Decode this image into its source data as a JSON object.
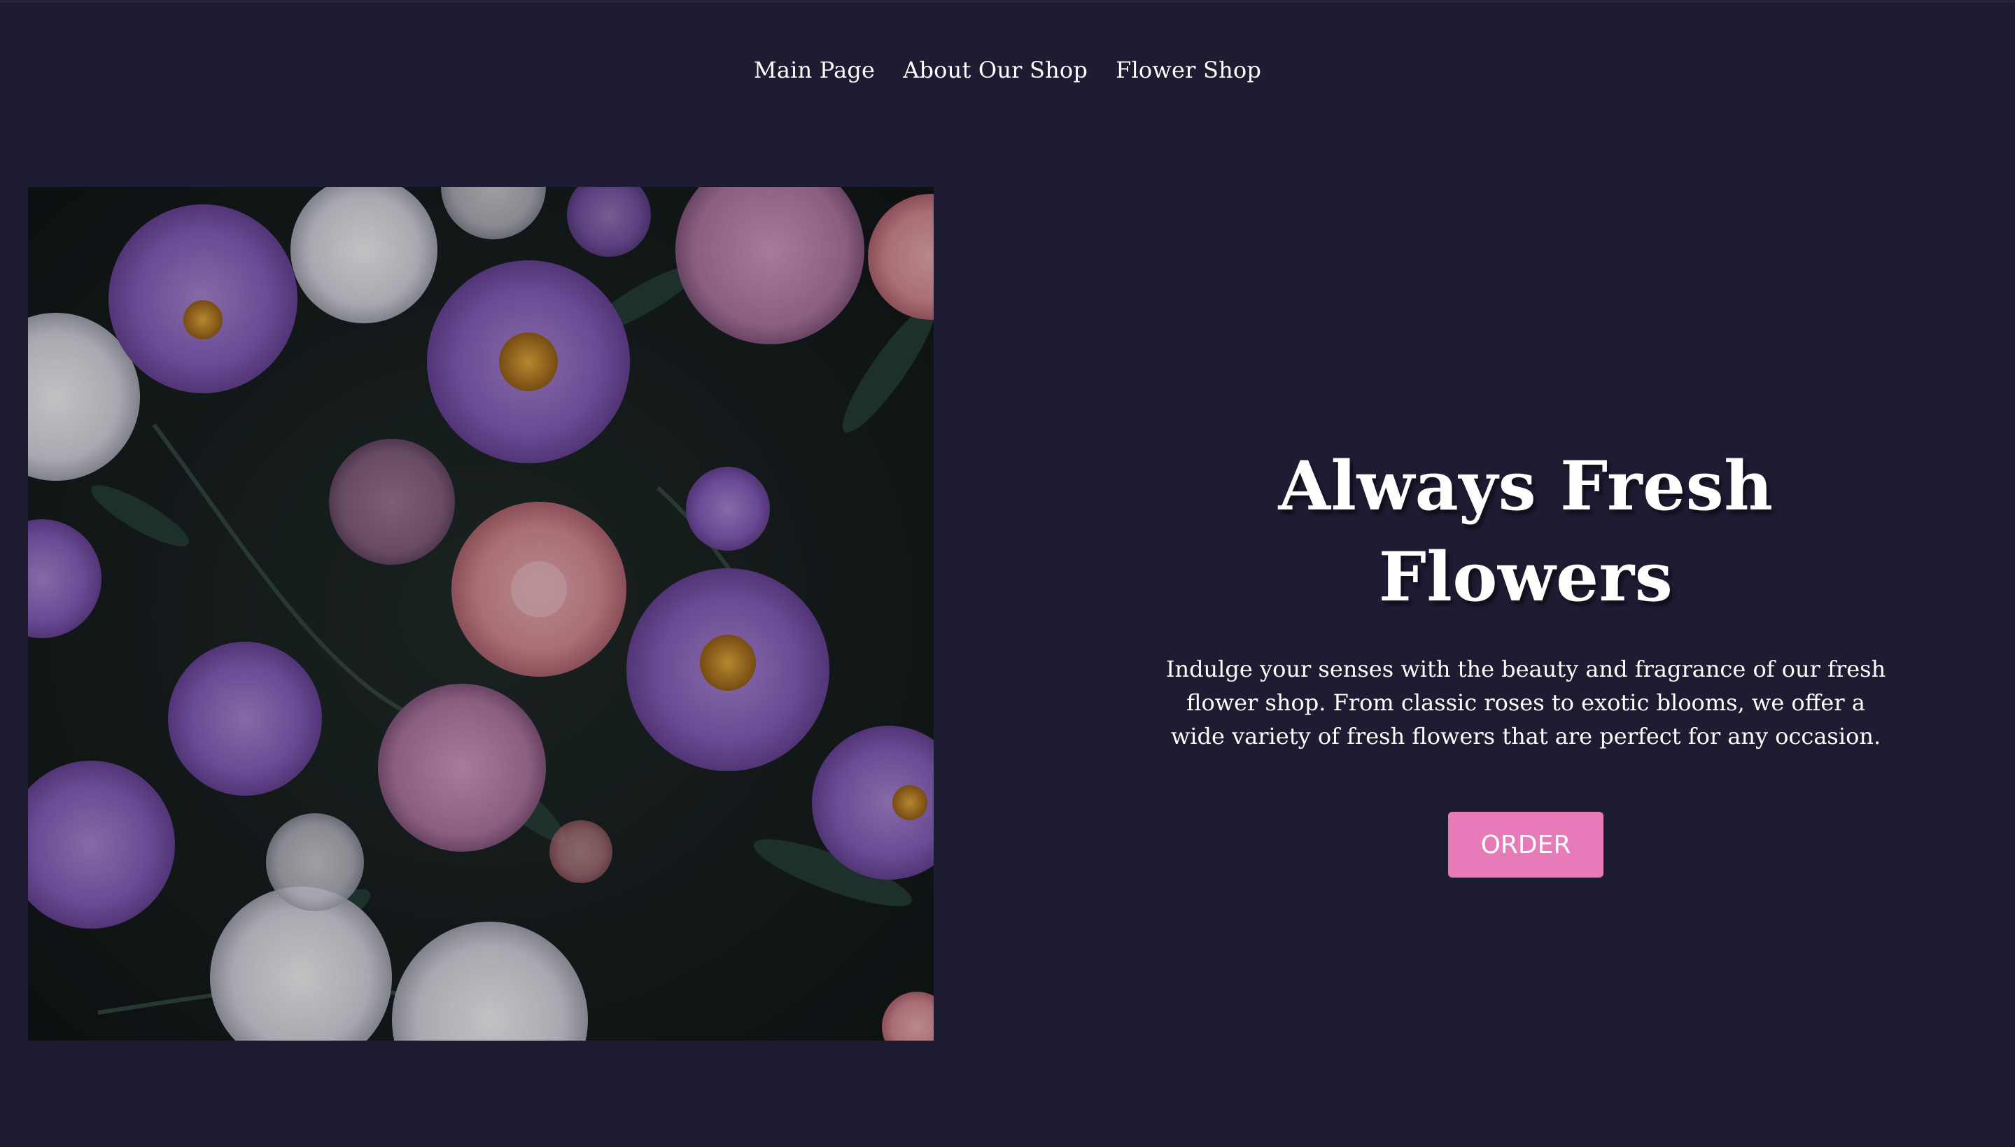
{
  "nav": {
    "items": [
      {
        "label": "Main Page"
      },
      {
        "label": "About Our Shop"
      },
      {
        "label": "Flower Shop"
      }
    ]
  },
  "hero": {
    "title": "Always Fresh Flowers",
    "description": "Indulge your senses with the beauty and fragrance of our fresh flower shop. From classic roses to exotic blooms, we offer a wide variety of fresh flowers that are perfect for any occasion.",
    "order_label": "ORDER",
    "image_subject": "purple, white and pink aster flowers on dark foliage"
  },
  "colors": {
    "background": "#1e1c33",
    "button": "#e77ab8",
    "text": "#ffffff"
  }
}
